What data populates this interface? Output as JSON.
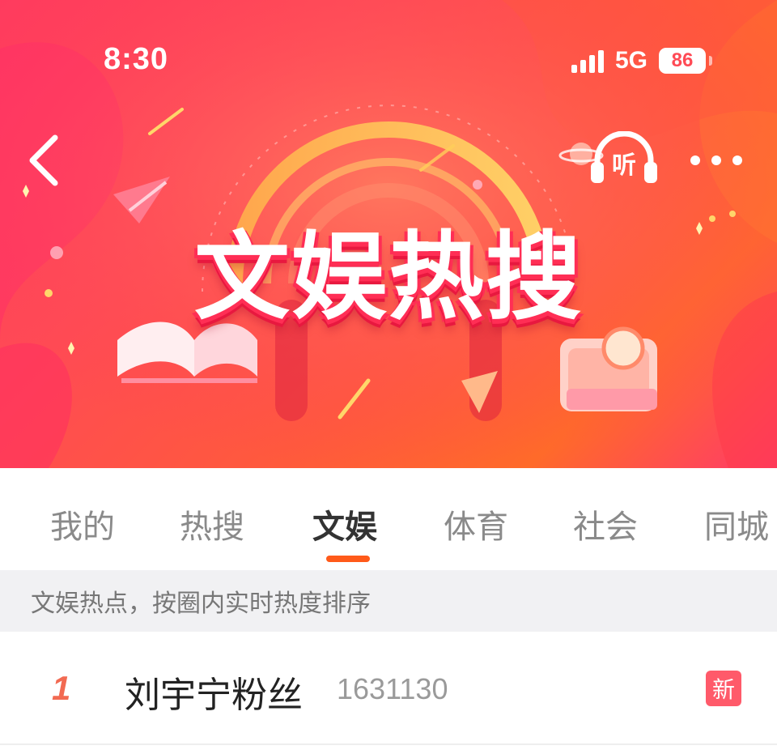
{
  "status_bar": {
    "time": "8:30",
    "network": "5G",
    "battery": "86"
  },
  "hero": {
    "title": "文娱热搜",
    "listen_label": "听",
    "colors": {
      "primary": "#ff4a55",
      "accent": "#ffd23a"
    }
  },
  "tabs": [
    {
      "label": "我的",
      "active": false
    },
    {
      "label": "热搜",
      "active": false
    },
    {
      "label": "文娱",
      "active": true
    },
    {
      "label": "体育",
      "active": false
    },
    {
      "label": "社会",
      "active": false
    },
    {
      "label": "同城",
      "active": false
    }
  ],
  "strip": {
    "text": "文娱热点，按圈内实时热度排序"
  },
  "list": [
    {
      "rank": "1",
      "topic": "刘宇宁粉丝",
      "heat": "1631130",
      "badge": "新"
    }
  ],
  "icons": {
    "back": "chevron-left-icon",
    "listen": "headphones-icon",
    "more": "more-dots-icon"
  }
}
